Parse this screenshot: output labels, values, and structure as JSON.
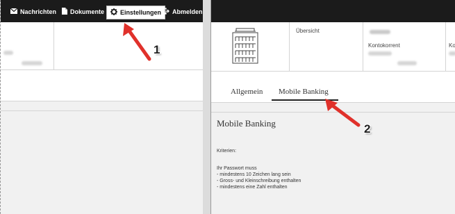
{
  "nav": {
    "messages": "Nachrichten",
    "documents": "Dokumente",
    "settings": "Einstellungen",
    "logout": "Abmelden"
  },
  "header": {
    "overview": "Übersicht",
    "account": "Kontokorrent",
    "account_cut": "Kon"
  },
  "tabs": {
    "general": "Allgemein",
    "mobile": "Mobile Banking"
  },
  "content": {
    "title": "Mobile Banking",
    "criteria": "Kriterien:",
    "intro": "Ihr Passwort muss",
    "rules": [
      "- mindestens 10 Zeichen lang sein",
      "- Gross- und Kleinschreibung enthalten",
      "- mindestens eine Zahl enthalten"
    ]
  },
  "annotations": {
    "step1": "1",
    "step2": "2"
  },
  "colors": {
    "topbar": "#1b1b1b",
    "arrow": "#e0312b",
    "tab_underline": "#222222"
  }
}
